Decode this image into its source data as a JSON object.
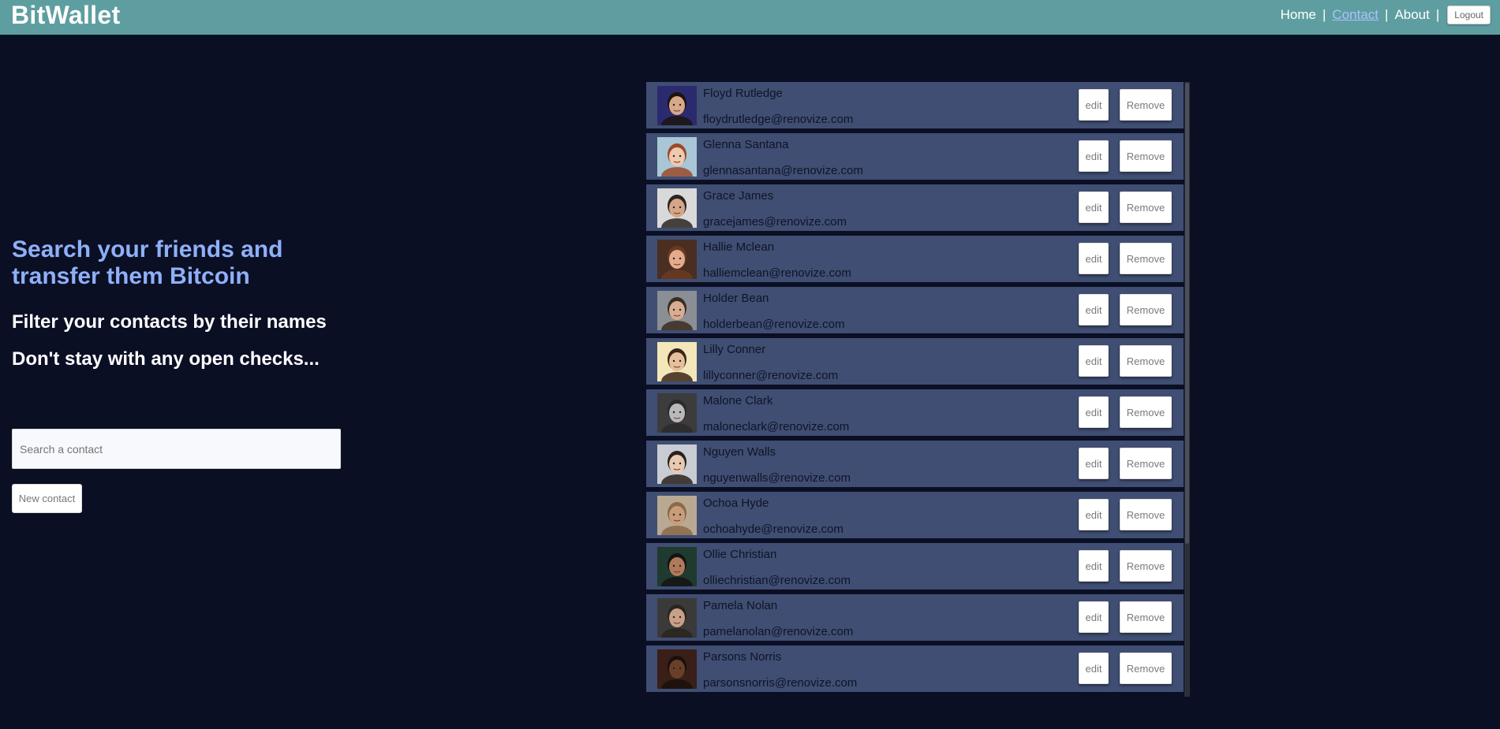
{
  "app": {
    "title": "BitWallet"
  },
  "nav": {
    "links": [
      {
        "label": "Home",
        "active": false
      },
      {
        "label": "Contact",
        "active": true
      },
      {
        "label": "About",
        "active": false
      }
    ],
    "logout_label": "Logout"
  },
  "hero": {
    "title": "Search your friends and transfer them Bitcoin",
    "line1": "Filter your contacts by their names",
    "line2": "Don't stay with any open checks..."
  },
  "search": {
    "placeholder": "Search a contact",
    "value": ""
  },
  "new_contact_label": "New contact",
  "contacts": [
    {
      "name": "Floyd Rutledge",
      "email": "floydrutledge@renovize.com",
      "edit_label": "edit",
      "remove_label": "Remove",
      "avatar": {
        "bg": "#2c2a6e",
        "skin": "#d9a88a",
        "hair": "#1b1410"
      }
    },
    {
      "name": "Glenna Santana",
      "email": "glennasantana@renovize.com",
      "edit_label": "edit",
      "remove_label": "Remove",
      "avatar": {
        "bg": "#a9c6d6",
        "skin": "#efc9b0",
        "hair": "#9a4a2a"
      }
    },
    {
      "name": "Grace James",
      "email": "gracejames@renovize.com",
      "edit_label": "edit",
      "remove_label": "Remove",
      "avatar": {
        "bg": "#d9d9d9",
        "skin": "#d6a588",
        "hair": "#2a2420"
      }
    },
    {
      "name": "Hallie Mclean",
      "email": "halliemclean@renovize.com",
      "edit_label": "edit",
      "remove_label": "Remove",
      "avatar": {
        "bg": "#4a2e22",
        "skin": "#e3ab8c",
        "hair": "#6b3a20"
      }
    },
    {
      "name": "Holder Bean",
      "email": "holderbean@renovize.com",
      "edit_label": "edit",
      "remove_label": "Remove",
      "avatar": {
        "bg": "#8a8f96",
        "skin": "#d8ad92",
        "hair": "#3a2b20"
      }
    },
    {
      "name": "Lilly Conner",
      "email": "lillyconner@renovize.com",
      "edit_label": "edit",
      "remove_label": "Remove",
      "avatar": {
        "bg": "#f3e6b8",
        "skin": "#e6bf9c",
        "hair": "#3b2417"
      }
    },
    {
      "name": "Malone Clark",
      "email": "maloneclark@renovize.com",
      "edit_label": "edit",
      "remove_label": "Remove",
      "avatar": {
        "bg": "#3c3c3c",
        "skin": "#b9b9b9",
        "hair": "#2a2a2a"
      }
    },
    {
      "name": "Nguyen Walls",
      "email": "nguyenwalls@renovize.com",
      "edit_label": "edit",
      "remove_label": "Remove",
      "avatar": {
        "bg": "#c9ccd2",
        "skin": "#e8c9b2",
        "hair": "#2b211c"
      }
    },
    {
      "name": "Ochoa Hyde",
      "email": "ochoahyde@renovize.com",
      "edit_label": "edit",
      "remove_label": "Remove",
      "avatar": {
        "bg": "#b9a892",
        "skin": "#c99c7a",
        "hair": "#8a6a48"
      }
    },
    {
      "name": "Ollie Christian",
      "email": "olliechristian@renovize.com",
      "edit_label": "edit",
      "remove_label": "Remove",
      "avatar": {
        "bg": "#1f3a2f",
        "skin": "#b07a5a",
        "hair": "#141414"
      }
    },
    {
      "name": "Pamela Nolan",
      "email": "pamelanolan@renovize.com",
      "edit_label": "edit",
      "remove_label": "Remove",
      "avatar": {
        "bg": "#3a3a3a",
        "skin": "#c8a088",
        "hair": "#2c241e"
      }
    },
    {
      "name": "Parsons Norris",
      "email": "parsonsnorris@renovize.com",
      "edit_label": "edit",
      "remove_label": "Remove",
      "avatar": {
        "bg": "#3a1e18",
        "skin": "#6a3f2a",
        "hair": "#1a100c"
      }
    }
  ]
}
